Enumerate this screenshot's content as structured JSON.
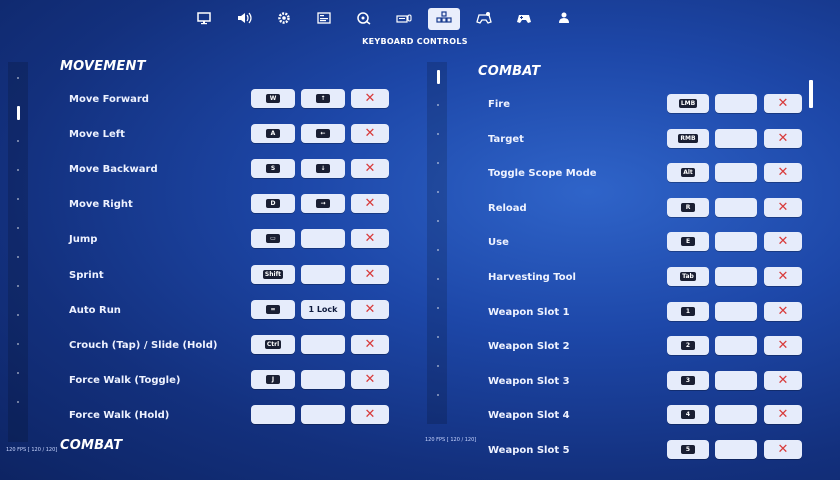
{
  "header": {
    "tabs": [
      {
        "icon": "monitor-icon"
      },
      {
        "icon": "speaker-icon"
      },
      {
        "icon": "gear-icon"
      },
      {
        "icon": "display-settings-icon"
      },
      {
        "icon": "accessibility-icon"
      },
      {
        "icon": "keyboard-mouse-icon"
      },
      {
        "icon": "keyboard-controls-icon",
        "active": true
      },
      {
        "icon": "controller-settings-icon"
      },
      {
        "icon": "gamepad-icon"
      },
      {
        "icon": "account-icon"
      }
    ],
    "title": "KEYBOARD CONTROLS"
  },
  "left": {
    "section_title": "MOVEMENT",
    "next_section_title": "COMBAT",
    "fps": "120 FPS [ 120 / 120]",
    "rows": [
      {
        "label": "Move Forward",
        "primary": "W",
        "secondary": "↑"
      },
      {
        "label": "Move Left",
        "primary": "A",
        "secondary": "←"
      },
      {
        "label": "Move Backward",
        "primary": "S",
        "secondary": "↓"
      },
      {
        "label": "Move Right",
        "primary": "D",
        "secondary": "→"
      },
      {
        "label": "Jump",
        "primary": "▭",
        "secondary": ""
      },
      {
        "label": "Sprint",
        "primary": "Shift",
        "secondary": ""
      },
      {
        "label": "Auto Run",
        "primary": "=",
        "secondary": "1 Lock"
      },
      {
        "label": "Crouch (Tap) / Slide (Hold)",
        "primary": "Ctrl",
        "secondary": ""
      },
      {
        "label": "Force Walk (Toggle)",
        "primary": "J",
        "secondary": ""
      },
      {
        "label": "Force Walk (Hold)",
        "primary": "",
        "secondary": ""
      }
    ]
  },
  "right": {
    "section_title": "COMBAT",
    "fps": "120 FPS [ 120 / 120]",
    "rows": [
      {
        "label": "Fire",
        "primary": "LMB",
        "secondary": ""
      },
      {
        "label": "Target",
        "primary": "RMB",
        "secondary": ""
      },
      {
        "label": "Toggle Scope Mode",
        "primary": "Alt",
        "secondary": ""
      },
      {
        "label": "Reload",
        "primary": "R",
        "secondary": ""
      },
      {
        "label": "Use",
        "primary": "E",
        "secondary": ""
      },
      {
        "label": "Harvesting Tool",
        "primary": "Tab",
        "secondary": ""
      },
      {
        "label": "Weapon Slot 1",
        "primary": "1",
        "secondary": ""
      },
      {
        "label": "Weapon Slot 2",
        "primary": "2",
        "secondary": ""
      },
      {
        "label": "Weapon Slot 3",
        "primary": "3",
        "secondary": ""
      },
      {
        "label": "Weapon Slot 4",
        "primary": "4",
        "secondary": ""
      },
      {
        "label": "Weapon Slot 5",
        "primary": "5",
        "secondary": ""
      }
    ]
  },
  "clear_symbol": "✕"
}
